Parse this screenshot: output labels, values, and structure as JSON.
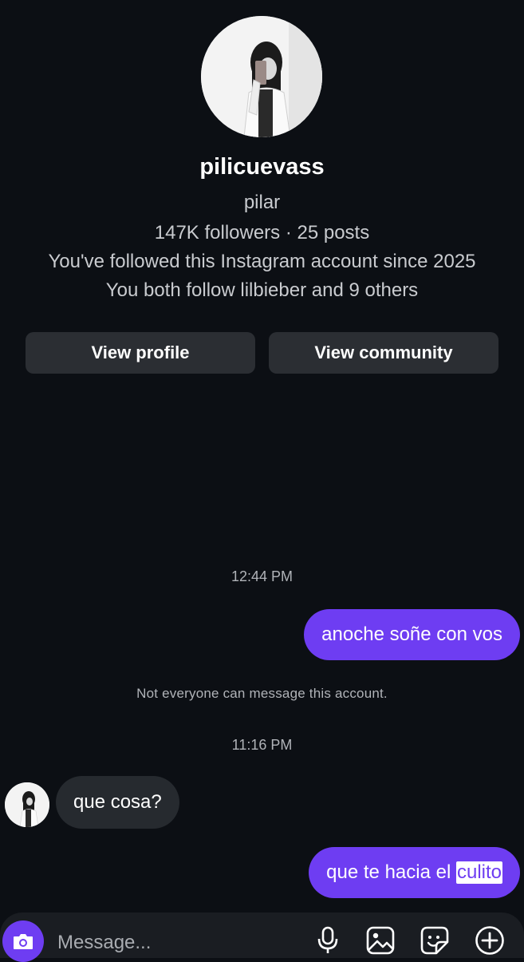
{
  "profile": {
    "username": "pilicuevass",
    "full_name": "pilar",
    "stats": "147K followers · 25 posts",
    "followed_since": "You've followed this Instagram account since 2025",
    "mutual": "You both follow lilbieber and 9 others",
    "view_profile_label": "View profile",
    "view_community_label": "View community"
  },
  "thread": {
    "timestamp_1": "12:44 PM",
    "message_1": "anoche soñe con vos",
    "notice": "Not everyone can message this account.",
    "timestamp_2": "11:16 PM",
    "message_2": "que cosa?",
    "message_3_prefix": "que te hacia el ",
    "message_3_redacted": "culito"
  },
  "composer": {
    "placeholder": "Message..."
  },
  "colors": {
    "background": "#0c0f14",
    "outgoing_bubble": "#6e3df2",
    "incoming_bubble": "#262a2f",
    "button": "#2b2e33"
  },
  "icons": [
    "camera-icon",
    "microphone-icon",
    "image-icon",
    "sticker-icon",
    "plus-icon"
  ]
}
